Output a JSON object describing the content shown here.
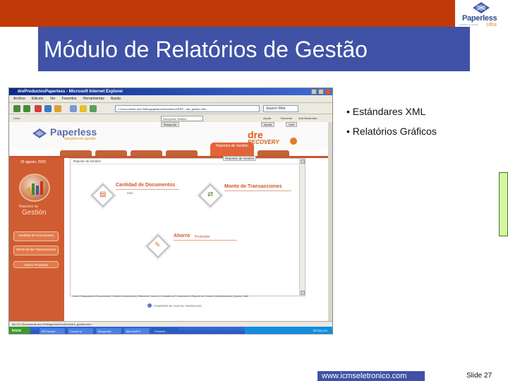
{
  "slide": {
    "title": "Módulo de Relatórios de Gestão",
    "bullets": [
      "• Estándares XML",
      "• Relatórios Gráficos"
    ],
    "url": "www.icmseletronico.com",
    "slide_number": "Slide 27"
  },
  "logo": {
    "name": "Paperless",
    "sub": "Ultra",
    "tagline": "soluções em gestão"
  },
  "browser": {
    "window_title": "dreProductosPaperless - Microsoft Internet Explorer",
    "menu": [
      "Archivo",
      "Edición",
      "Ver",
      "Favoritos",
      "Herramientas",
      "Ayuda"
    ],
    "address": "C:\\Documents and Settings\\gestion\\Escritorio\\2\\ERP - dre_gestion.htm",
    "search_label": "Search Web",
    "links": {
      "field": "Recuperar Gestión",
      "item1": "Links",
      "item2": "Ayuda",
      "item3": "Recorder",
      "item4": "Add Bookmark"
    },
    "status": "file:///C:/Documents and Settings/dre/Escritorio/dre_gestion.htm"
  },
  "app": {
    "logo_name": "Paperless",
    "logo_sub": "soluções em gestão",
    "dre": "dre",
    "dre_sub": "RECOVERY",
    "active_tab": "Reportes de Gestión",
    "top_tabs": [
      "Búsqueda",
      "Ayuda",
      "Salir"
    ],
    "date": "25 agosto, 2005",
    "report_label_1": "Reportes de",
    "report_label_2": "Gestión",
    "side_buttons": [
      "Cantidad de Documentos",
      "Monto de las Transacciones",
      "Ahorro Promedio"
    ],
    "content_title": "Reporte de Gestión",
    "breadcrumb": "Reportes de Gestión",
    "modules": {
      "m1_title": "Cantidad de Documentos",
      "m1_sub": "DOC",
      "m2_title": "Monto de Transacciones",
      "m3_title": "Ahorro",
      "m3_sub": "Promedio"
    },
    "footer_links": "Inicio | Búsqueda de Documentos | Gestión Documental | Oficina de Correos | Consulta de Proveedores | Reporte de Gestión | Administración | Ayuda | Salir",
    "footer_brand": "POWERED BY DIGITAL PAPERLESS"
  },
  "taskbar": {
    "start": "Inicio",
    "items": [
      "MS-Noved...",
      "Correo w...",
      "Busqueda...",
      "Microsoft P...",
      "Producti..."
    ],
    "clock": "04:15 p.m."
  },
  "colors": {
    "red": "#c03a08",
    "blue": "#3f52a6",
    "green": "#d5f5a3"
  }
}
